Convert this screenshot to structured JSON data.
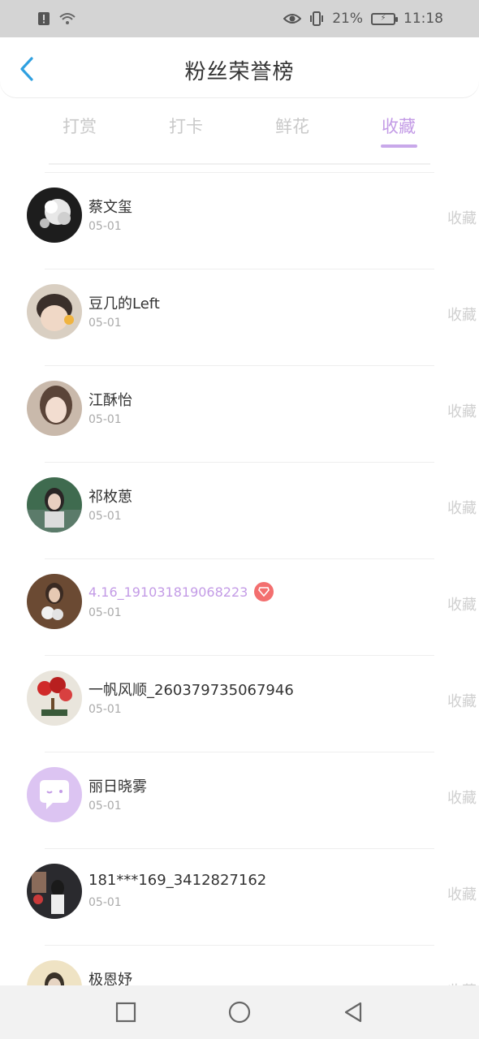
{
  "status_bar": {
    "battery": "21%",
    "time": "11:18",
    "icons": [
      "sim-alert-icon",
      "wifi-icon",
      "eye-icon",
      "vibrate-icon",
      "battery-charging-icon"
    ]
  },
  "header": {
    "title": "粉丝荣誉榜",
    "back_icon": "chevron-left-icon"
  },
  "tabs": [
    {
      "label": "打赏",
      "active": false
    },
    {
      "label": "打卡",
      "active": false
    },
    {
      "label": "鲜花",
      "active": false
    },
    {
      "label": "收藏",
      "active": true
    }
  ],
  "list": [
    {
      "name": "蔡文玺",
      "date": "05-01",
      "action": "收藏",
      "avatar": "white-flowers",
      "vip": false
    },
    {
      "name": "豆几的Left",
      "date": "05-01",
      "action": "收藏",
      "avatar": "child-photo",
      "vip": false
    },
    {
      "name": "江酥怡",
      "date": "05-01",
      "action": "收藏",
      "avatar": "girl-portrait",
      "vip": false
    },
    {
      "name": "祁枚葸",
      "date": "05-01",
      "action": "收藏",
      "avatar": "outdoor-girl",
      "vip": false
    },
    {
      "name": "4.16_191031819068223",
      "date": "05-01",
      "action": "收藏",
      "avatar": "bouquet-girl",
      "vip": true
    },
    {
      "name": "一帆风顺_260379735067946",
      "date": "05-01",
      "action": "收藏",
      "avatar": "red-tree",
      "vip": false
    },
    {
      "name": "丽日晓雾",
      "date": "05-01",
      "action": "收藏",
      "avatar": "default-chat-avatar",
      "vip": false
    },
    {
      "name": "181***169_3412827162",
      "date": "05-01",
      "action": "收藏",
      "avatar": "dark-figure",
      "vip": false
    },
    {
      "name": "极恩妤",
      "date": "",
      "action": "收藏",
      "avatar": "light-portrait",
      "vip": false
    }
  ],
  "nav": [
    "square-recent-icon",
    "circle-home-icon",
    "triangle-back-icon"
  ],
  "colors": {
    "accent": "#c39be6",
    "inactive_tab": "#c9c9c9",
    "back_arrow": "#2fa0e0",
    "vip_badge": "#f36f6f"
  }
}
